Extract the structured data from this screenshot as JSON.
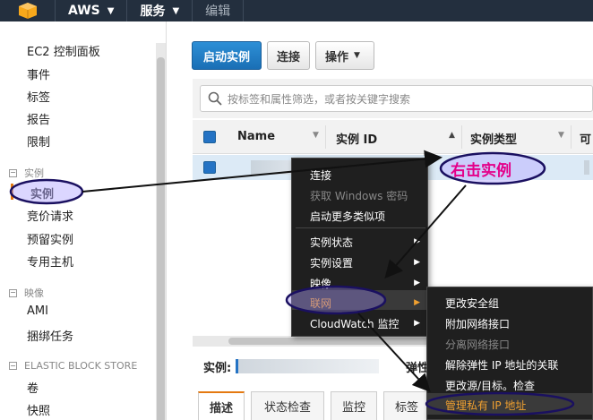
{
  "topbar": {
    "brand": "AWS",
    "services": "服务",
    "edit": "编辑"
  },
  "sidebar": {
    "items": [
      {
        "label": "EC2 控制面板"
      },
      {
        "label": "事件"
      },
      {
        "label": "标签"
      },
      {
        "label": "报告"
      },
      {
        "label": "限制"
      }
    ],
    "sections": [
      {
        "label": "实例",
        "items": [
          "实例",
          "竞价请求",
          "预留实例",
          "专用主机"
        ]
      },
      {
        "label": "映像",
        "items": [
          "AMI",
          "捆绑任务"
        ]
      },
      {
        "label": "ELASTIC BLOCK STORE",
        "items": [
          "卷",
          "快照"
        ]
      }
    ],
    "active": "实例"
  },
  "toolbar": {
    "launch": "启动实例",
    "connect": "连接",
    "actions": "操作"
  },
  "search": {
    "placeholder": "按标签和属性筛选，或者按关键字搜索"
  },
  "table": {
    "columns": [
      "Name",
      "实例 ID",
      "实例类型",
      "可"
    ]
  },
  "context_menu": {
    "items": [
      {
        "label": "连接",
        "enabled": true
      },
      {
        "label": "获取 Windows 密码",
        "enabled": false
      },
      {
        "label": "启动更多类似项",
        "enabled": true
      },
      {
        "label": "实例状态",
        "submenu": true
      },
      {
        "label": "实例设置",
        "submenu": true
      },
      {
        "label": "映像",
        "submenu": true
      },
      {
        "label": "联网",
        "submenu": true
      },
      {
        "label": "CloudWatch 监控",
        "submenu": true
      }
    ]
  },
  "submenu": {
    "items": [
      {
        "label": "更改安全组",
        "enabled": true
      },
      {
        "label": "附加网络接口",
        "enabled": true
      },
      {
        "label": "分离网络接口",
        "enabled": false
      },
      {
        "label": "解除弹性 IP 地址的关联",
        "enabled": true
      },
      {
        "label": "更改源/目标。检查",
        "enabled": true
      },
      {
        "label": "管理私有 IP 地址",
        "enabled": true
      }
    ]
  },
  "details": {
    "instance_label": "实例:",
    "elastic_label": "弹性"
  },
  "tabs": [
    "描述",
    "状态检查",
    "监控",
    "标签"
  ],
  "annotation": {
    "callout": "右击实例"
  },
  "colors": {
    "accent": "#e47911",
    "nav": "#232f3e",
    "primary": "#1a6fb5",
    "annotation": "#e4008a"
  }
}
